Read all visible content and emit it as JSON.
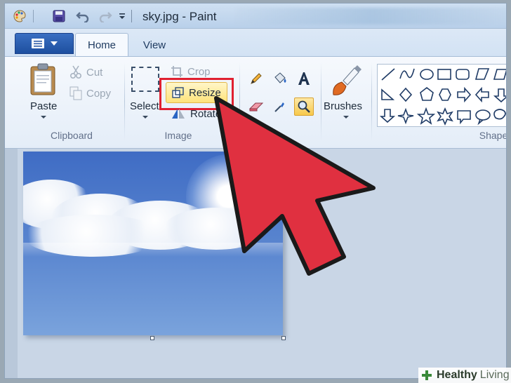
{
  "window": {
    "title": "sky.jpg - Paint"
  },
  "tabs": [
    {
      "label": "Home",
      "active": true
    },
    {
      "label": "View",
      "active": false
    }
  ],
  "clipboard": {
    "group_label": "Clipboard",
    "paste_label": "Paste",
    "cut_label": "Cut",
    "copy_label": "Copy"
  },
  "image_group": {
    "group_label": "Image",
    "select_label": "Select",
    "crop_label": "Crop",
    "resize_label": "Resize",
    "rotate_label": "Rotate"
  },
  "tools": {
    "items": [
      "pencil-icon",
      "fill-icon",
      "text-icon",
      "eraser-icon",
      "color-picker-icon",
      "magnifier-icon"
    ],
    "selected": "magnifier-icon"
  },
  "brushes": {
    "label": "Brushes"
  },
  "shapes": {
    "group_label": "Shape"
  },
  "highlight_color": "#e02030",
  "pointer_color": "#e03040",
  "watermark": {
    "brand_bold": "Healthy",
    "brand_light": "Living"
  }
}
